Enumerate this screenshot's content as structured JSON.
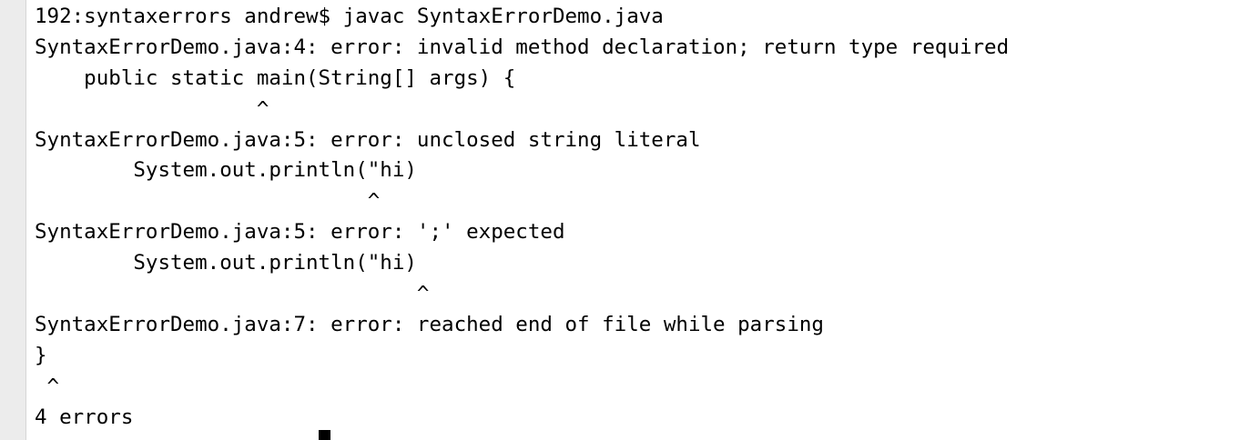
{
  "terminal": {
    "lines": [
      "192:syntaxerrors andrew$ javac SyntaxErrorDemo.java",
      "SyntaxErrorDemo.java:4: error: invalid method declaration; return type required",
      "    public static main(String[] args) {",
      "                  ^",
      "SyntaxErrorDemo.java:5: error: unclosed string literal",
      "        System.out.println(\"hi)",
      "                           ^",
      "SyntaxErrorDemo.java:5: error: ';' expected",
      "        System.out.println(\"hi)",
      "                               ^",
      "SyntaxErrorDemo.java:7: error: reached end of file while parsing",
      "}",
      " ^",
      "4 errors"
    ]
  }
}
